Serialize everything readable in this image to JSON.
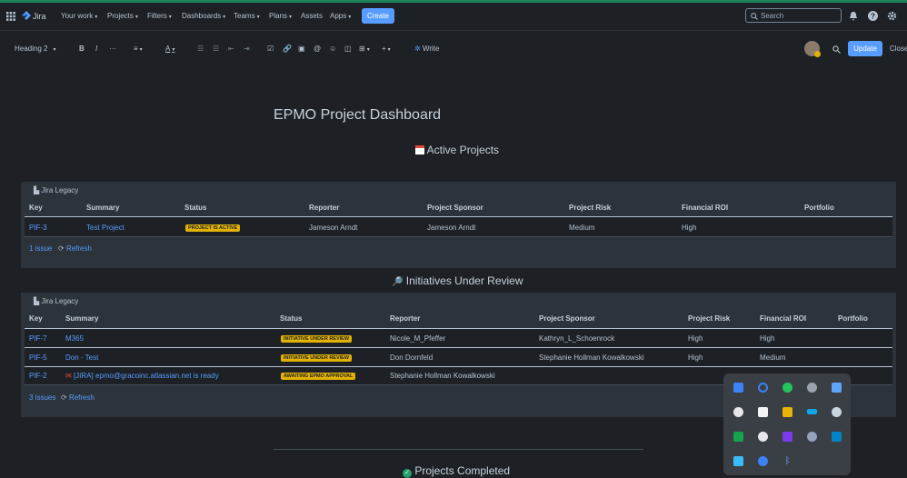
{
  "nav": {
    "logo": "Jira",
    "items": [
      "Your work",
      "Projects",
      "Filters",
      "Dashboards",
      "Teams",
      "Plans",
      "Assets",
      "Apps"
    ],
    "create": "Create",
    "search_placeholder": "Search"
  },
  "toolbar": {
    "style": "Heading 2",
    "write": "Write",
    "update": "Update",
    "close": "Close"
  },
  "page": {
    "title": "EPMO Project Dashboard",
    "active_title": "Active Projects",
    "review_title": "Initiatives Under Review",
    "completed_title": "Projects Completed"
  },
  "table1": {
    "label": "Jira Legacy",
    "headers": [
      "Key",
      "Summary",
      "Status",
      "Reporter",
      "Project Sponsor",
      "Project Risk",
      "Financial ROI",
      "Portfolio"
    ],
    "rows": [
      [
        "PIF-3",
        "Test Project",
        "PROJECT IS ACTIVE",
        "Jameson Arndt",
        "Jameson Arndt",
        "Medium",
        "High",
        ""
      ]
    ],
    "count": "1 issue",
    "refresh": "Refresh"
  },
  "table2": {
    "label": "Jira Legacy",
    "headers": [
      "Key",
      "Summary",
      "Status",
      "Reporter",
      "Project Sponsor",
      "Project Risk",
      "Financial ROI",
      "Portfolio"
    ],
    "rows": [
      [
        "PIF-7",
        "M365",
        "INITIATIVE UNDER REVIEW",
        "Nicole_M_Pfeffer",
        "Kathryn_L_Schoenrock",
        "High",
        "High",
        ""
      ],
      [
        "PIF-5",
        "Don - Test",
        "INITIATIVE UNDER REVIEW",
        "Don Dornfeld",
        "Stephanie Hollman Kowalkowski",
        "High",
        "Medium",
        ""
      ],
      [
        "PIF-2",
        "[JIRA] epmo@gracoinc.atlassian.net is ready",
        "AWAITING EPMO APPROVAL",
        "Stephanie Hollman Kowalkowski",
        "",
        "",
        "",
        ""
      ]
    ],
    "count": "3 issues",
    "refresh": "Refresh"
  },
  "colors": {
    "accent": "#579dff",
    "lozenge": "#e2b203",
    "topline": "#1f845a"
  }
}
